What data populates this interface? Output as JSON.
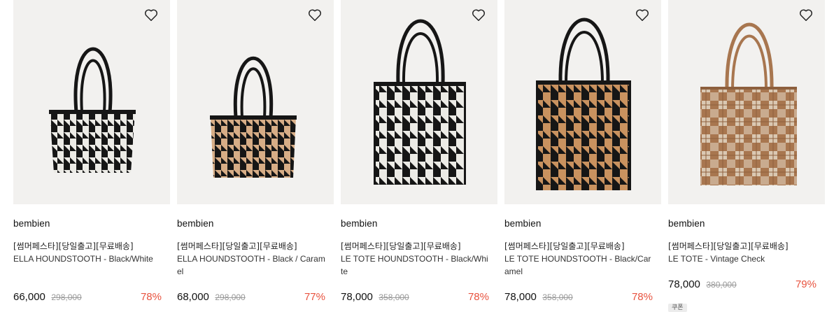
{
  "products": [
    {
      "brand": "bembien",
      "tag": "[썸머페스타][당일출고][무료배송]",
      "name": "ELLA HOUNDSTOOTH - Black/White",
      "price": "66,000",
      "original_price": "298,000",
      "discount": "78%",
      "icon": "heart-outline-icon",
      "colors": {
        "primary": "#161616",
        "secondary": "#ecebe6"
      }
    },
    {
      "brand": "bembien",
      "tag": "[썸머페스타][당일출고][무료배송]",
      "name": "ELLA HOUNDSTOOTH - Black / Caramel",
      "price": "68,000",
      "original_price": "298,000",
      "discount": "77%",
      "icon": "heart-outline-icon",
      "colors": {
        "primary": "#161616",
        "secondary": "#d7ad86"
      }
    },
    {
      "brand": "bembien",
      "tag": "[썸머페스타][당일출고][무료배송]",
      "name": "LE TOTE HOUNDSTOOTH - Black/White",
      "price": "78,000",
      "original_price": "358,000",
      "discount": "78%",
      "icon": "heart-outline-icon",
      "colors": {
        "primary": "#161616",
        "secondary": "#ecebe6"
      }
    },
    {
      "brand": "bembien",
      "tag": "[썸머페스타][당일출고][무료배송]",
      "name": "LE TOTE HOUNDSTOOTH - Black/Caramel",
      "price": "78,000",
      "original_price": "358,000",
      "discount": "78%",
      "icon": "heart-outline-icon",
      "colors": {
        "primary": "#161616",
        "secondary": "#c9925f"
      }
    },
    {
      "brand": "bembien",
      "tag": "[썸머페스타][당일출고][무료배송]",
      "name": "LE TOTE - Vintage Check",
      "price": "78,000",
      "original_price": "380,000",
      "discount": "79%",
      "coupon": "쿠폰",
      "icon": "heart-outline-icon",
      "colors": {
        "primary": "#a8764f",
        "secondary": "#e3d6c3"
      }
    }
  ],
  "theme": {
    "accent": "#e8533f",
    "image_bg": "#f2f1ef"
  }
}
